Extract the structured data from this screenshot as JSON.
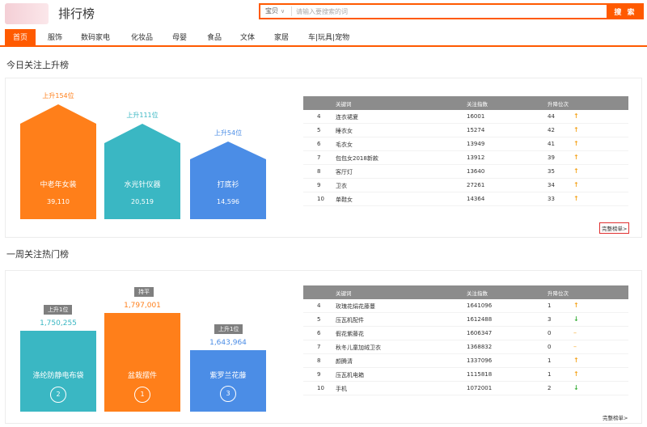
{
  "header": {
    "title": "排行榜",
    "search_select": "宝贝",
    "search_placeholder": "请输入要搜索的词",
    "search_button": "搜 索"
  },
  "nav": {
    "items": [
      "首页",
      "服饰",
      "数码家电",
      "化妆品",
      "母婴",
      "食品",
      "文体",
      "家居",
      "车|玩具|宠物"
    ]
  },
  "section1": {
    "title": "今日关注上升榜",
    "bars": [
      {
        "top_label": "上升154位",
        "name": "中老年女装",
        "value": "39,110",
        "color": "#ff7f1a",
        "label_color": "#ff7f1a",
        "value_num": 39110
      },
      {
        "top_label": "上升111位",
        "name": "水光针仪器",
        "value": "20,519",
        "color": "#3ab7c3",
        "label_color": "#3ab7c3",
        "value_num": 20519
      },
      {
        "top_label": "上升54位",
        "name": "打底衫",
        "value": "14,596",
        "color": "#4b8de6",
        "label_color": "#4b8de6",
        "value_num": 14596
      }
    ],
    "table": {
      "headers": [
        "关键词",
        "关注指数",
        "升降位次"
      ],
      "rows": [
        {
          "rank": "4",
          "keyword": "连衣裙夏",
          "index": "16001",
          "change": "44",
          "trend": "up"
        },
        {
          "rank": "5",
          "keyword": "睡衣女",
          "index": "15274",
          "change": "42",
          "trend": "up"
        },
        {
          "rank": "6",
          "keyword": "毛衣女",
          "index": "13949",
          "change": "41",
          "trend": "up"
        },
        {
          "rank": "7",
          "keyword": "包包女2018新款",
          "index": "13912",
          "change": "39",
          "trend": "up"
        },
        {
          "rank": "8",
          "keyword": "客厅灯",
          "index": "13640",
          "change": "35",
          "trend": "up"
        },
        {
          "rank": "9",
          "keyword": "卫衣",
          "index": "27261",
          "change": "34",
          "trend": "up"
        },
        {
          "rank": "10",
          "keyword": "单鞋女",
          "index": "14364",
          "change": "33",
          "trend": "up"
        }
      ]
    },
    "more": "完整榜单>"
  },
  "section2": {
    "title": "一周关注热门榜",
    "bars": [
      {
        "tag": "上升1位",
        "value": "1,750,255",
        "name": "涤纶防静电布袋",
        "rank": "2",
        "color": "#3ab7c3",
        "value_color": "#3ab7c3",
        "value_num": 1750255
      },
      {
        "tag": "持平",
        "value": "1,797,001",
        "name": "盆栽摆件",
        "rank": "1",
        "color": "#ff7f1a",
        "value_color": "#ff7f1a",
        "value_num": 1797001
      },
      {
        "tag": "上升1位",
        "value": "1,643,964",
        "name": "紫罗兰花藤",
        "rank": "3",
        "color": "#4b8de6",
        "value_color": "#4b8de6",
        "value_num": 1643964
      }
    ],
    "table": {
      "headers": [
        "关键词",
        "关注指数",
        "升降位次"
      ],
      "rows": [
        {
          "rank": "4",
          "keyword": "玫瑰花绢花藤蔓",
          "index": "1641096",
          "change": "1",
          "trend": "up"
        },
        {
          "rank": "5",
          "keyword": "压瓦机配件",
          "index": "1612488",
          "change": "3",
          "trend": "down"
        },
        {
          "rank": "6",
          "keyword": "假花紫藤花",
          "index": "1606347",
          "change": "0",
          "trend": "flat"
        },
        {
          "rank": "7",
          "keyword": "秋冬儿童加绒卫衣",
          "index": "1368832",
          "change": "0",
          "trend": "flat"
        },
        {
          "rank": "8",
          "keyword": "颜腾清",
          "index": "1337096",
          "change": "1",
          "trend": "up"
        },
        {
          "rank": "9",
          "keyword": "压瓦机电箱",
          "index": "1115818",
          "change": "1",
          "trend": "up"
        },
        {
          "rank": "10",
          "keyword": "手机",
          "index": "1072001",
          "change": "2",
          "trend": "down"
        }
      ]
    },
    "more": "完整榜单>"
  },
  "icons": {
    "trend_up": "arrow-up-icon",
    "trend_down": "arrow-down-icon",
    "trend_flat": "dash-icon"
  },
  "colors": {
    "accent": "#ff5a00"
  }
}
